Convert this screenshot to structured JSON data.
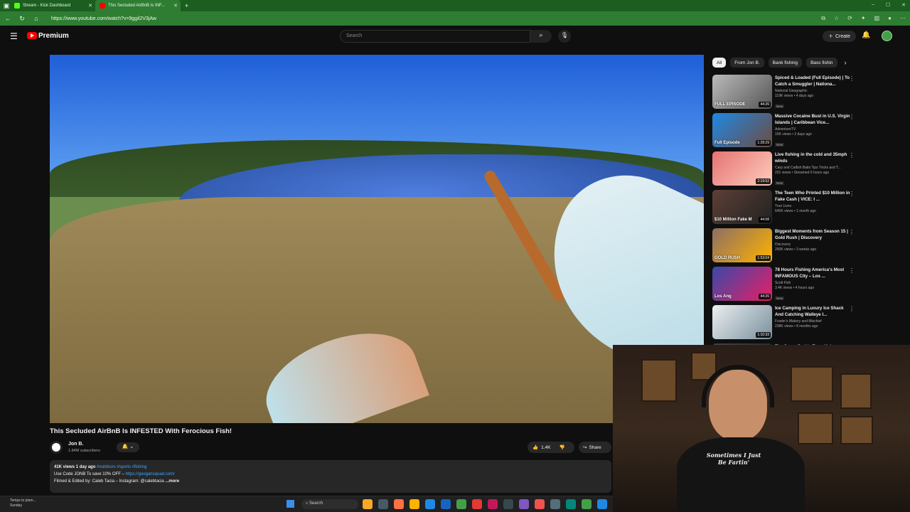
{
  "browser": {
    "tabs": [
      {
        "label": "Stream - Kick Dashboard",
        "favicon_color": "#53fc18",
        "active": false
      },
      {
        "label": "This Secluded AirBnB Is INF...",
        "favicon_color": "#ff0000",
        "active": true
      }
    ],
    "new_tab": "+",
    "url": "https://www.youtube.com/watch?v=9ggil2V3jAw"
  },
  "header": {
    "brand": "Premium",
    "search_placeholder": "Search",
    "create_label": "Create"
  },
  "video": {
    "title": "This Secluded AirBnB Is INFESTED With Ferocious Fish!",
    "channel": "Jon B.",
    "subscribers": "1.84M subscribers",
    "likes": "1.4K",
    "share_label": "Share",
    "views_age": "41K views  1 day ago",
    "hashtags": "#outdoors #sports #fishing",
    "desc_line1": "Use Code JONB To save 10% OFF – ",
    "desc_link": "https://googansquad.com/",
    "desc_line2": "Filmed & Edited by: Caleb Tacia – Instagram: @calebtacia",
    "more_label": "...more"
  },
  "chips": [
    "All",
    "From Jon B.",
    "Bank fishing",
    "Bass fishin"
  ],
  "recommendations": [
    {
      "title": "Spiced & Loaded (Full Episode) | To Catch a Smuggler | Nationa...",
      "channel": "National Geographic",
      "stats": "119K views • 4 days ago",
      "badge": "New",
      "duration": "44:26",
      "thumb": "linear-gradient(135deg,#bbb,#555)",
      "overlay": "FULL EPISODE"
    },
    {
      "title": "Massive Cocaine Bust in U.S. Virgin Islands | Caribbean Vice...",
      "channel": "AdventureTV",
      "stats": "15K views • 2 days ago",
      "badge": "New",
      "duration": "1:28:29",
      "thumb": "linear-gradient(135deg,#1e88e5,#6d4c41)",
      "overlay": "Full Episode"
    },
    {
      "title": "Live fishing in the cold and 35mph winds",
      "channel": "Carp and Catfish Baits Tips Tricks and T...",
      "stats": "231 views • Streamed 6 hours ago",
      "badge": "New",
      "duration": "2:19:52",
      "thumb": "linear-gradient(135deg,#e57373,#ffccbc)",
      "overlay": ""
    },
    {
      "title": "The Teen Who Printed $10 Million in Fake Cash | VICE: I ...",
      "channel": "True Lives",
      "stats": "645K views • 1 month ago",
      "badge": "",
      "duration": "44:08",
      "thumb": "linear-gradient(135deg,#5d4037,#212121)",
      "overlay": "$10 Million Fake M"
    },
    {
      "title": "Biggest Moments from Season 15 | Gold Rush | Discovery",
      "channel": "Discovery",
      "stats": "250K views • 3 weeks ago",
      "badge": "",
      "duration": "1:53:04",
      "thumb": "linear-gradient(135deg,#8d6e63,#ffb300)",
      "overlay": "GOLD RUSH"
    },
    {
      "title": "78 Hours Fishing America's Most INFAMOUS City – Los ...",
      "channel": "Scott Fish",
      "stats": "3.4K views • 4 hours ago",
      "badge": "New",
      "duration": "44:26",
      "thumb": "linear-gradient(135deg,#3949ab,#e91e63)",
      "overlay": "Los Ang"
    },
    {
      "title": "Ice Camping in Luxury Ice Shack And Catching Walleye I...",
      "channel": "Fowler's Makery and Mischief",
      "stats": "238K views • 8 months ago",
      "badge": "",
      "duration": "1:10:33",
      "thumb": "linear-gradient(135deg,#eceff1,#78909c)",
      "overlay": ""
    },
    {
      "title": "The Sugar Daddy Trap: Kelsey",
      "channel": "",
      "stats": "",
      "badge": "",
      "duration": "",
      "thumb": "linear-gradient(135deg,#444,#222)",
      "overlay": ""
    }
  ],
  "webcam": {
    "shirt_text": "Sometimes I Just Be Fartin'"
  },
  "taskbar": {
    "weather_line1": "Temps to plum...",
    "weather_line2": "Sunday",
    "search_label": "Search",
    "apps": [
      "#f9a825",
      "#455a64",
      "#ff7043",
      "#ffb300",
      "#1e88e5",
      "#1565c0",
      "#43a047",
      "#e53935",
      "#c2185b",
      "#37474f",
      "#7e57c2",
      "#ef5350",
      "#546e7a",
      "#00897b",
      "#43a047",
      "#1e88e5"
    ]
  }
}
